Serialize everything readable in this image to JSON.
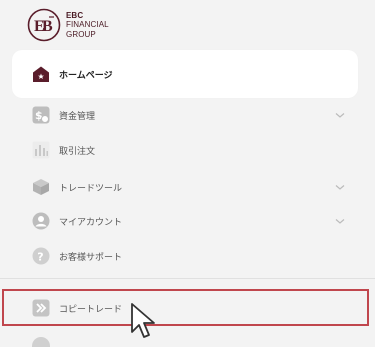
{
  "logo": {
    "line1": "EBC",
    "line2": "FINANCIAL",
    "line3": "GROUP"
  },
  "menu": {
    "items": [
      {
        "label": "ホームページ",
        "icon": "home-icon",
        "active": true
      },
      {
        "label": "資金管理",
        "icon": "fund-icon",
        "expandable": true
      },
      {
        "label": "取引注文",
        "icon": "chart-icon"
      },
      {
        "label": "トレードツール",
        "icon": "cube-icon",
        "expandable": true
      },
      {
        "label": "マイアカウント",
        "icon": "user-icon",
        "expandable": true
      },
      {
        "label": "お客様サポート",
        "icon": "help-icon"
      },
      {
        "label": "コピートレード",
        "icon": "copy-trade-icon",
        "highlighted": true
      }
    ]
  },
  "colors": {
    "brand": "#5a1d2b",
    "icon_gray": "#b9b9b9",
    "highlight_border": "#c0464d",
    "background": "#f3f3f3"
  }
}
